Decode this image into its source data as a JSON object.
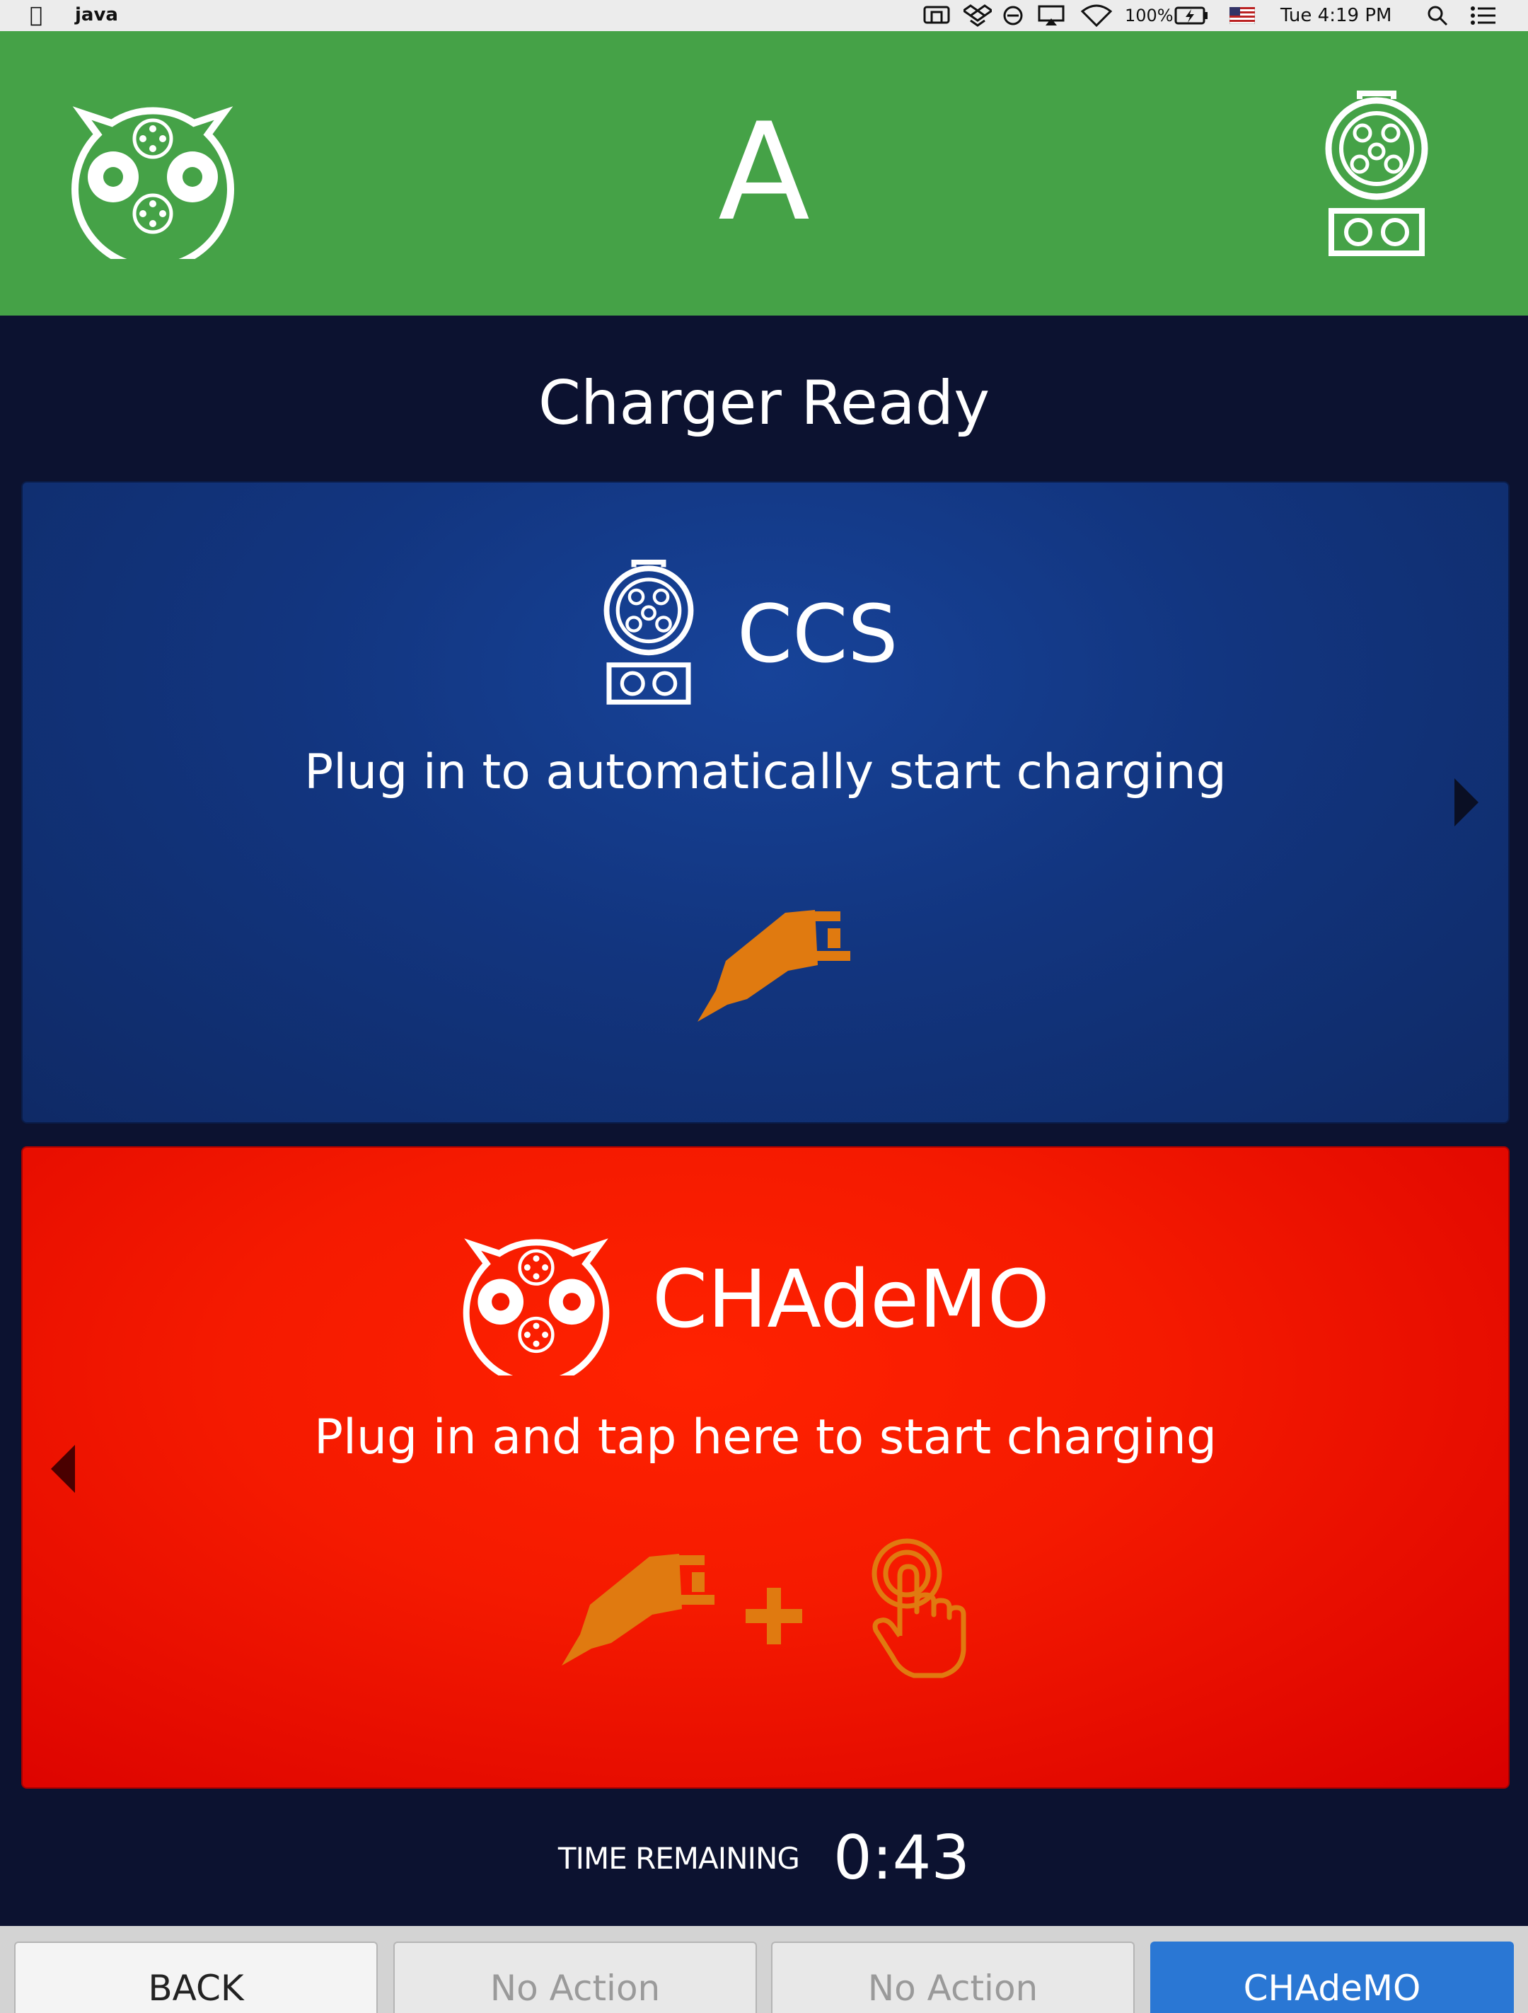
{
  "menubar": {
    "app_name": "java",
    "battery": "100%",
    "clock": "Tue 4:19 PM"
  },
  "header": {
    "dispenser_letter": "A",
    "left_icon": "chademo-connector-icon",
    "right_icon": "ccs-connector-icon",
    "color": "#45a247"
  },
  "status_title": "Charger Ready",
  "ccs": {
    "name": "CCS",
    "instruction": "Plug in to automatically start charging",
    "color": "#12357f"
  },
  "chademo": {
    "name": "CHAdeMO",
    "instruction": "Plug in and tap here to start charging",
    "color": "#f51a00"
  },
  "timer": {
    "label": "TIME REMAINING",
    "value": "0:43"
  },
  "buttons": {
    "back": "BACK",
    "no_action_1": "No Action",
    "no_action_2": "No Action",
    "chademo": "CHAdeMO"
  },
  "accent_color": "#e07a10"
}
